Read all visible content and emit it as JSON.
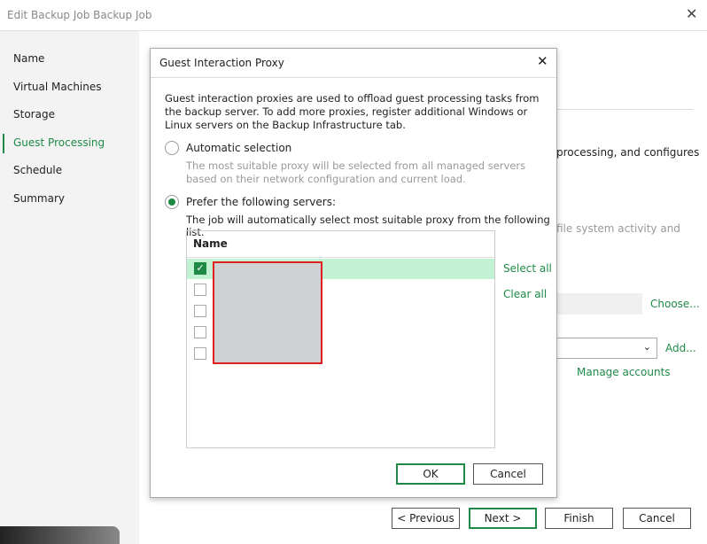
{
  "window": {
    "title": "Edit Backup Job Backup Job",
    "close_icon": "close-icon"
  },
  "sidebar": {
    "items": [
      {
        "label": "Name"
      },
      {
        "label": "Virtual Machines"
      },
      {
        "label": "Storage"
      },
      {
        "label": "Guest Processing",
        "active": true
      },
      {
        "label": "Schedule"
      },
      {
        "label": "Summary"
      }
    ]
  },
  "main": {
    "text1": "processing, and configures",
    "text2": "file system activity and",
    "choose_label": "Choose...",
    "add_label": "Add...",
    "manage_accounts_label": "Manage accounts"
  },
  "footer": {
    "previous": "< Previous",
    "next": "Next >",
    "finish": "Finish",
    "cancel": "Cancel"
  },
  "dialog": {
    "title": "Guest Interaction Proxy",
    "description": "Guest interaction proxies are used to offload guest processing tasks from the backup server. To add more proxies, register additional Windows or Linux servers on the Backup Infrastructure tab.",
    "option_auto": {
      "label": "Automatic selection",
      "hint": "The most suitable proxy will be selected from all managed servers based on their network configuration and current load.",
      "selected": false
    },
    "option_prefer": {
      "label": "Prefer the following servers:",
      "hint": "The job will automatically select most suitable proxy from the following list.",
      "selected": true
    },
    "list": {
      "header": "Name",
      "rows": [
        {
          "checked": true
        },
        {
          "checked": false
        },
        {
          "checked": false
        },
        {
          "checked": false
        },
        {
          "checked": false
        }
      ]
    },
    "select_all": "Select all",
    "clear_all": "Clear all",
    "ok": "OK",
    "cancel": "Cancel"
  },
  "colors": {
    "accent": "#1e8a46",
    "selected_row": "#c2f2d3",
    "redaction_border": "#e02020"
  }
}
